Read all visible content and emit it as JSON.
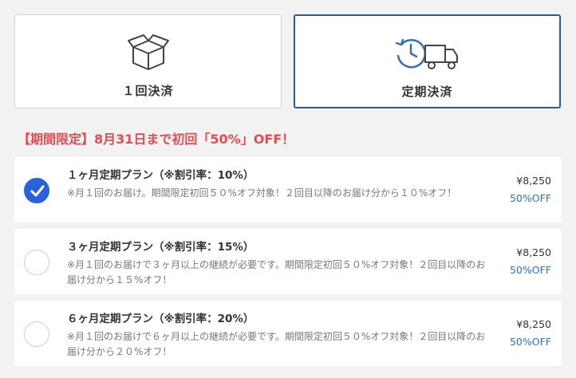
{
  "payment_tabs": {
    "one_time": {
      "label": "１回決済",
      "icon": "box-icon",
      "selected": false
    },
    "subscription": {
      "label": "定期決済",
      "icon": "delivery-truck-clock-icon",
      "selected": true
    }
  },
  "promo_banner": "【期間限定】8月31日まで初回「50%」OFF！",
  "plans": [
    {
      "title": "１ヶ月定期プラン（※割引率：10%）",
      "description": "※月１回のお届け。期間限定初回５０%オフ対象！２回目以降のお届け分から１０%オフ！",
      "price": "¥8,250",
      "discount": "50%OFF",
      "selected": true
    },
    {
      "title": "３ヶ月定期プラン（※割引率：15%）",
      "description": "※月１回のお届けで３ヶ月以上の継続が必要です。期間限定初回５０%オフ対象！２回目以降のお届け分から１５%オフ！",
      "price": "¥8,250",
      "discount": "50%OFF",
      "selected": false
    },
    {
      "title": "６ヶ月定期プラン（※割引率：20%）",
      "description": "※月１回のお届けで６ヶ月以上の継続が必要です。期間限定初回５０%オフ対象！２回目以降のお届け分から２０%オフ！",
      "price": "¥8,250",
      "discount": "50%OFF",
      "selected": false
    }
  ],
  "colors": {
    "accent_blue": "#2b62d9",
    "active_border": "#2d5b8f",
    "promo_red": "#e04d52",
    "discount_blue": "#3a6ea8"
  }
}
